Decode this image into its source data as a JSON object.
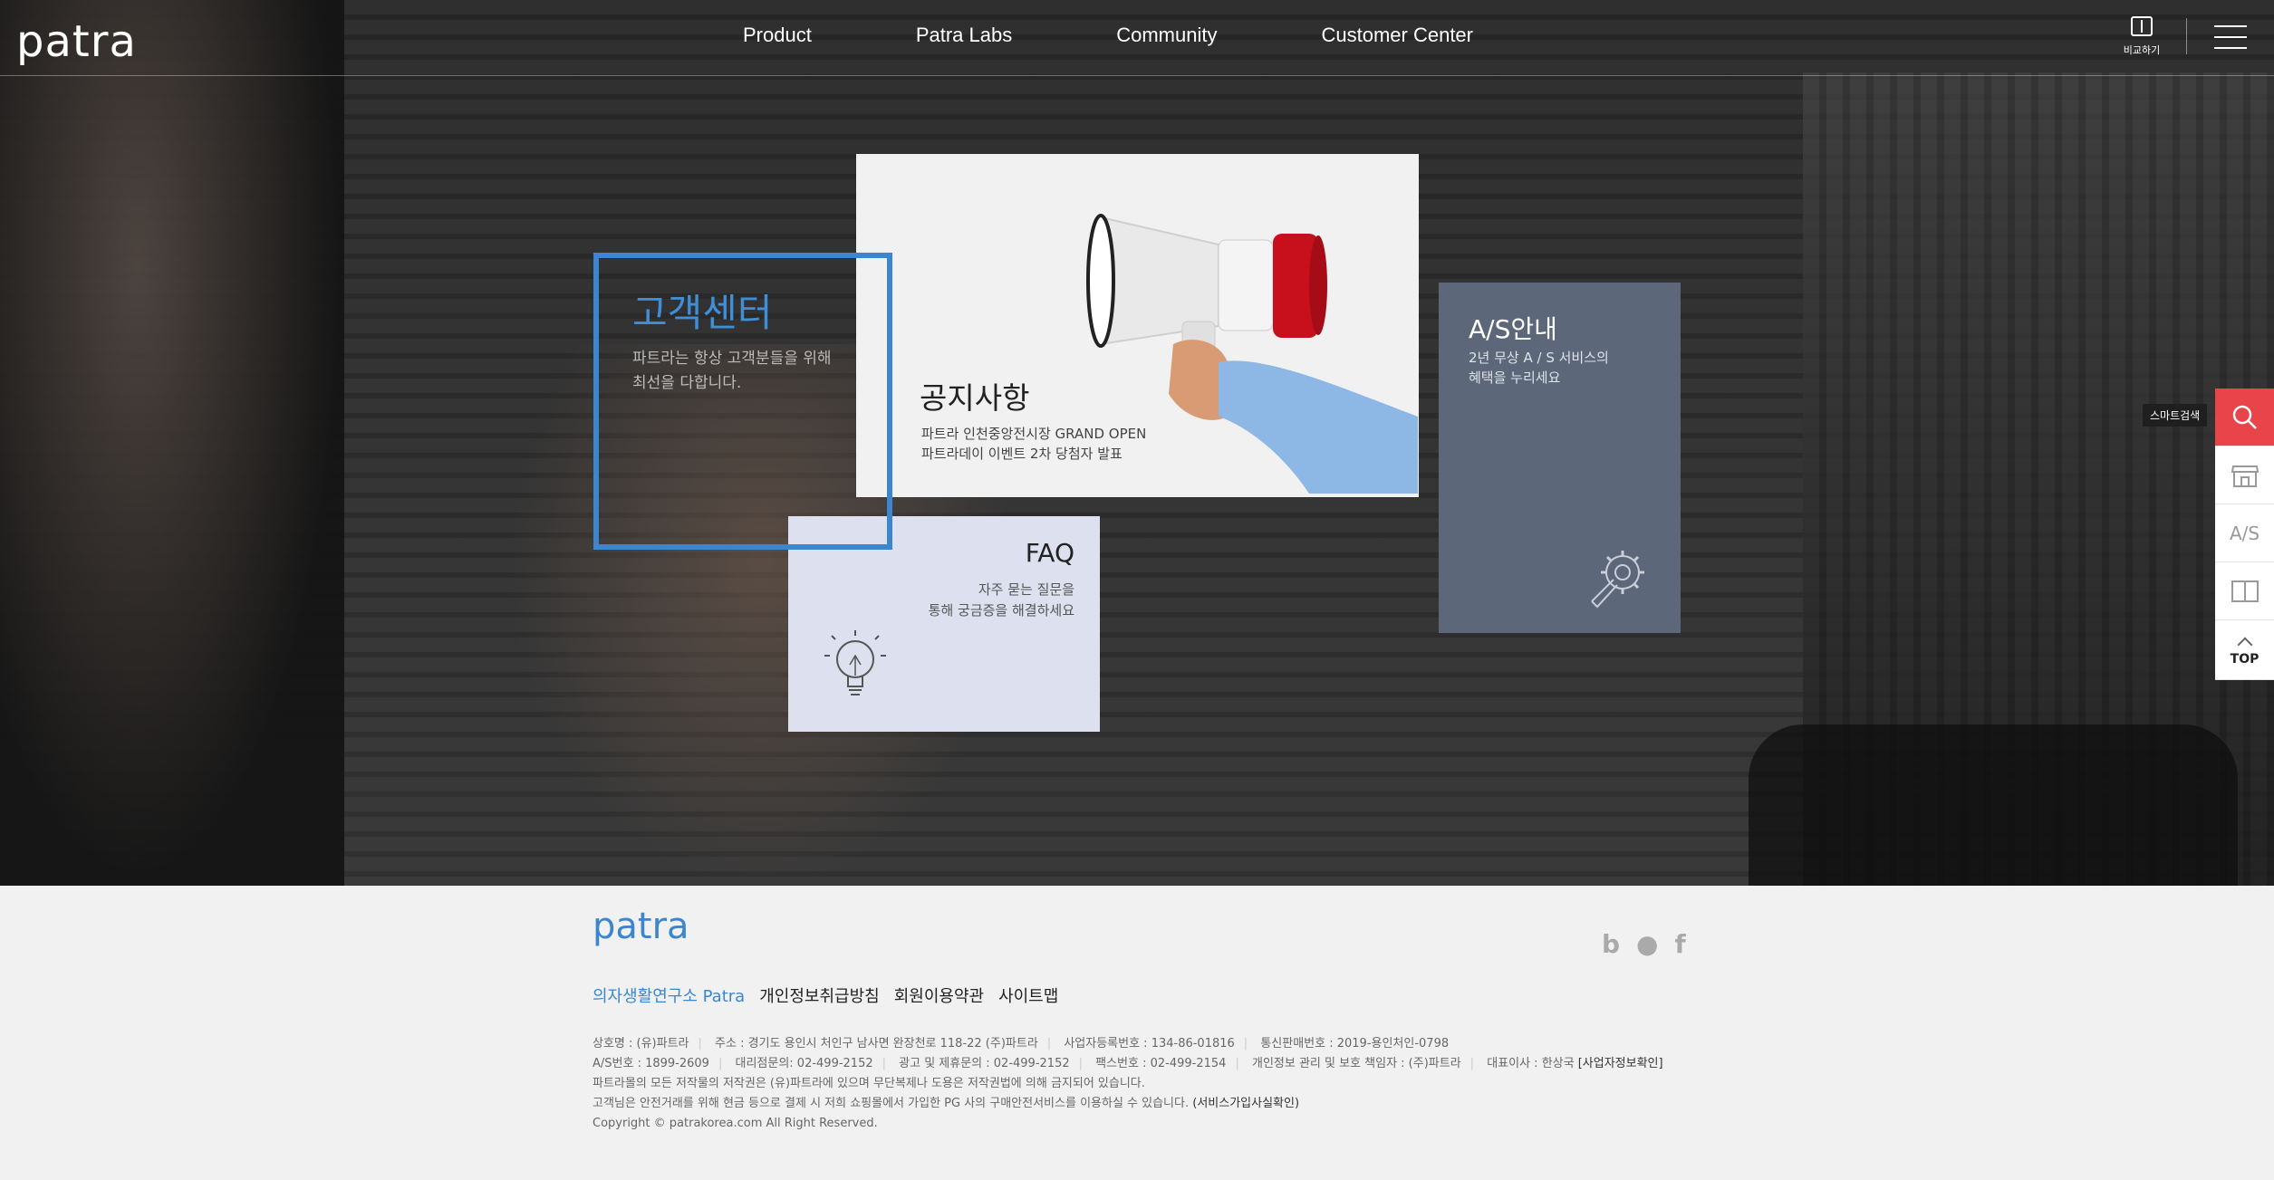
{
  "header": {
    "logo": "patra",
    "nav": [
      "Product",
      "Patra Labs",
      "Community",
      "Customer Center"
    ],
    "compare_label": "비교하기"
  },
  "customer_center": {
    "title": "고객센터",
    "line1": "파트라는 항상 고객분들을 위해",
    "line2": "최선을 다합니다."
  },
  "notice": {
    "title": "공지사항",
    "line1": "파트라 인천중앙전시장 GRAND OPEN",
    "line2": "파트라데이 이벤트 2차 당첨자 발표"
  },
  "faq": {
    "title": "FAQ",
    "line1": "자주 묻는 질문을",
    "line2": "통해 궁금증을 해결하세요"
  },
  "as": {
    "title": "A/S안내",
    "line1": "2년 무상 A / S 서비스의",
    "line2": "혜택을 누리세요"
  },
  "quick_menu": {
    "tooltip": "스마트검색",
    "as_label": "A/S",
    "top_label": "TOP"
  },
  "footer": {
    "logo": "patra",
    "links": [
      "의자생활연구소 Patra",
      "개인정보취급방침",
      "회원이용약관",
      "사이트맵"
    ],
    "info_row1": [
      "상호명 : (유)파트라",
      "주소 : 경기도 용인시 처인구 남사면 완장천로 118-22 (주)파트라",
      "사업자등록번호 : 134-86-01816",
      "통신판매번호 : 2019-용인처인-0798"
    ],
    "info_row2": [
      "A/S번호 : 1899-2609",
      "대리점문의: 02-499-2152",
      "광고 및 제휴문의 : 02-499-2152",
      "팩스번호 : 02-499-2154",
      "개인정보 관리 및 보호 책임자 : (주)파트라",
      "대표이사 : 한상국"
    ],
    "info_row2_link": "[사업자정보확인]",
    "info_row3": "파트라몰의 모든 저작물의 저작권은 (유)파트라에 있으며 무단복제나 도용은 저작권법에 의해 금지되어 있습니다.",
    "info_row4": "고객님은 안전거래를 위해 현금 등으로 결제 시 저희 쇼핑몰에서 가입한 PG 사의 구매안전서비스를 이용하실 수 있습니다.",
    "info_row4_link": "(서비스가입사실확인)",
    "copyright": "Copyright © patrakorea.com All Right Reserved."
  },
  "colors": {
    "accent_blue": "#3b86cf",
    "as_card": "#5d677a",
    "faq_card": "#dde0ee",
    "search_red": "#e8444a"
  }
}
